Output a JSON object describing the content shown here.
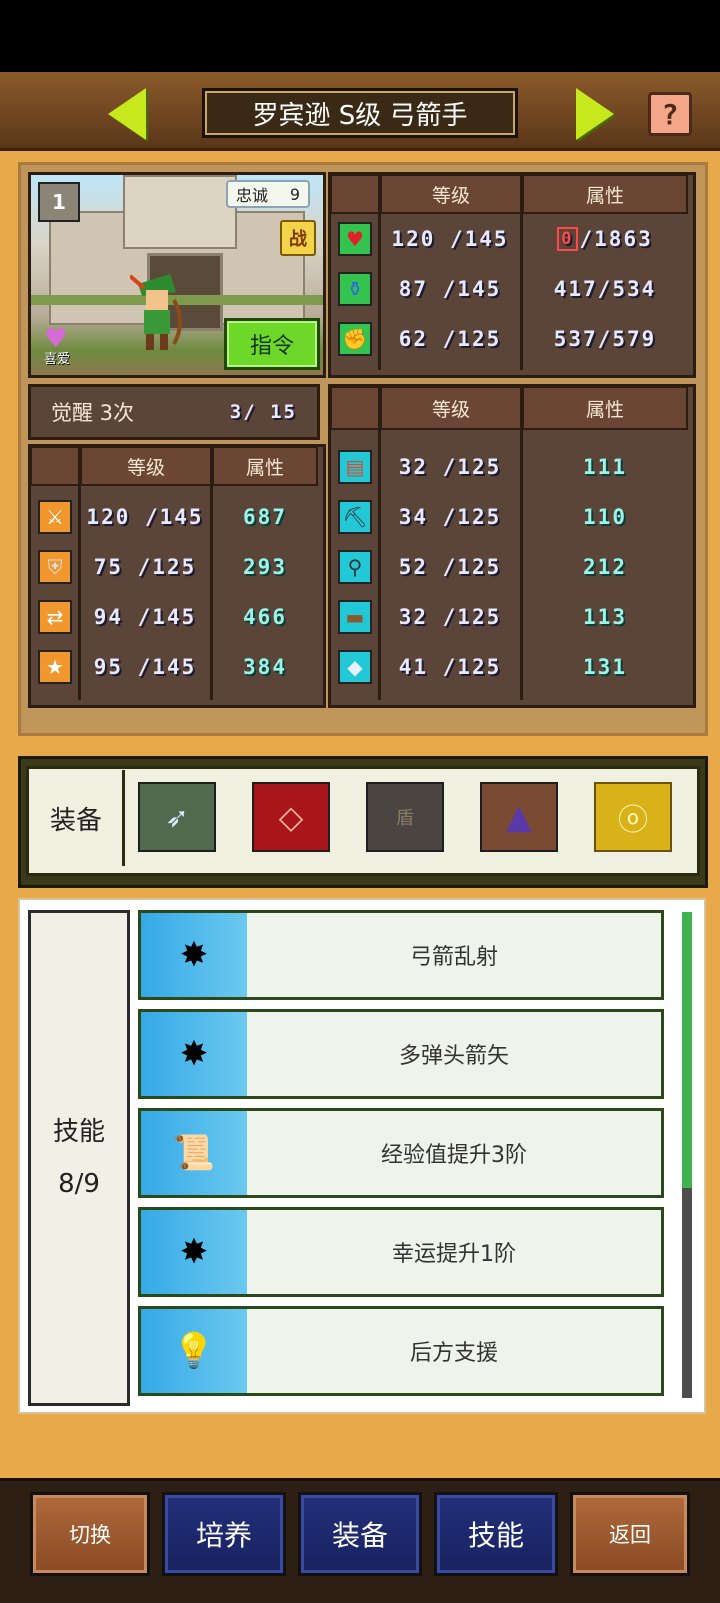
{
  "header": {
    "title": "罗宾逊 S级 弓箭手",
    "help_label": "?"
  },
  "portrait": {
    "badge": "1",
    "loyalty_label": "忠诚",
    "loyalty_value": "9",
    "battle_label": "战",
    "command_label": "指令",
    "favorite_label": "喜爱"
  },
  "vitals": {
    "col_level": "等级",
    "col_attr": "属性",
    "rows": [
      {
        "icon": "heart-icon",
        "level": "120 /145",
        "attr_current": "0",
        "attr_max": "/1863"
      },
      {
        "icon": "mana-potion-icon",
        "level": "87 /145",
        "attr_current": "417",
        "attr_max": "/534"
      },
      {
        "icon": "stamina-icon",
        "level": "62 /125",
        "attr_current": "537",
        "attr_max": "/579"
      }
    ]
  },
  "awaken": {
    "label": "觉醒 3次",
    "progress": "3/  15"
  },
  "combat": {
    "col_level": "等级",
    "col_attr": "属性",
    "rows": [
      {
        "icon": "sword-icon",
        "level": "120 /145",
        "attr": "687"
      },
      {
        "icon": "shield-icon",
        "level": "75 /125",
        "attr": "293"
      },
      {
        "icon": "arrows-icon",
        "level": "94 /145",
        "attr": "466"
      },
      {
        "icon": "star-icon",
        "level": "95 /145",
        "attr": "384"
      }
    ]
  },
  "crafting": {
    "col_level": "等级",
    "col_attr": "属性",
    "rows": [
      {
        "icon": "book-icon",
        "level": "32 /125",
        "attr": "111"
      },
      {
        "icon": "pickaxe-icon",
        "level": "34 /125",
        "attr": "110"
      },
      {
        "icon": "shovel-icon",
        "level": "52 /125",
        "attr": "212"
      },
      {
        "icon": "anvil-icon",
        "level": "32 /125",
        "attr": "113"
      },
      {
        "icon": "crystal-icon",
        "level": "41 /125",
        "attr": "131"
      }
    ]
  },
  "equipment": {
    "label": "装备",
    "slots": [
      {
        "name": "bow-weapon-icon",
        "text": ""
      },
      {
        "name": "red-armor-icon",
        "text": ""
      },
      {
        "name": "shield-slot-empty",
        "text": "盾"
      },
      {
        "name": "hood-icon",
        "text": ""
      },
      {
        "name": "amulet-icon",
        "text": ""
      }
    ]
  },
  "skills": {
    "label": "技能",
    "count": "8/9",
    "items": [
      {
        "icon": "arrow-burst-icon",
        "name": "弓箭乱射"
      },
      {
        "icon": "arrow-burst-icon",
        "name": "多弹头箭矢"
      },
      {
        "icon": "scroll-icon",
        "name": "经验值提升3阶"
      },
      {
        "icon": "arrow-burst-icon",
        "name": "幸运提升1阶"
      },
      {
        "icon": "lightbulb-icon",
        "name": "后方支援"
      }
    ]
  },
  "nav": {
    "switch": "切换",
    "train": "培养",
    "equip": "装备",
    "skill": "技能",
    "back": "返回"
  },
  "colors": {
    "accent_green": "#c6e81d",
    "panel_brown": "#5b4538",
    "nav_blue": "#23307a",
    "nav_brown": "#b06a3c"
  }
}
